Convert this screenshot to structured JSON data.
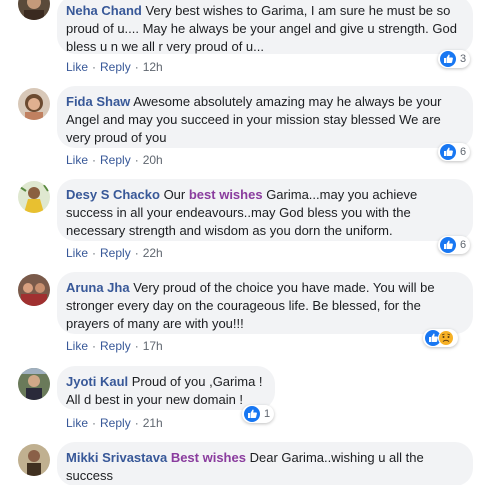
{
  "colors": {
    "author": "#385898",
    "highlight": "#8a3c9e",
    "bubble_bg": "#f2f3f5",
    "like_blue": "#1877f2",
    "meta_grey": "#606770"
  },
  "labels": {
    "like": "Like",
    "reply": "Reply",
    "separator": "·"
  },
  "comments": [
    {
      "author": "Neha Chand",
      "lines": [
        "Very best wishes to Garima, I am sure he must be so",
        "proud of u.... May he always be your angel and give u strength. God",
        "bless u n we all r very proud of u..."
      ],
      "time": "12h",
      "reaction_count": "3",
      "reaction_icons": [
        "like-icon"
      ]
    },
    {
      "author": "Fida Shaw",
      "lines": [
        "Awesome absolutely amazing may he always be your",
        "Angel and may you succeed in your mission stay blessed We are",
        "very proud of you"
      ],
      "time": "20h",
      "reaction_count": "6",
      "reaction_icons": [
        "like-icon"
      ]
    },
    {
      "author": "Desy S Chacko",
      "highlight": "best wishes",
      "lines": [
        "Our",
        "Garima...may you achieve",
        "success in all your endeavours..may God bless you with the",
        "necessary strength and wisdom as you dorn the uniform."
      ],
      "time": "22h",
      "reaction_count": "6",
      "reaction_icons": [
        "like-icon"
      ]
    },
    {
      "author": "Aruna Jha",
      "lines": [
        "Very proud of the choice you have made. You will be",
        "stronger every day on the courageous life. Be blessed, for the",
        "prayers of many are with you!!!"
      ],
      "time": "17h",
      "reaction_count": "",
      "reaction_icons": [
        "like-icon",
        "sad-icon"
      ]
    },
    {
      "author": "Jyoti Kaul",
      "lines": [
        "Proud of you ,Garima !",
        "All d best in your new domain !"
      ],
      "time": "21h",
      "reaction_count": "1",
      "reaction_icons": [
        "like-icon"
      ]
    },
    {
      "author": "Mikki Srivastava",
      "highlight": "Best wishes",
      "lines": [
        "Dear Garima..wishing u all the",
        "success"
      ],
      "time": "",
      "reaction_count": "",
      "reaction_icons": []
    }
  ]
}
